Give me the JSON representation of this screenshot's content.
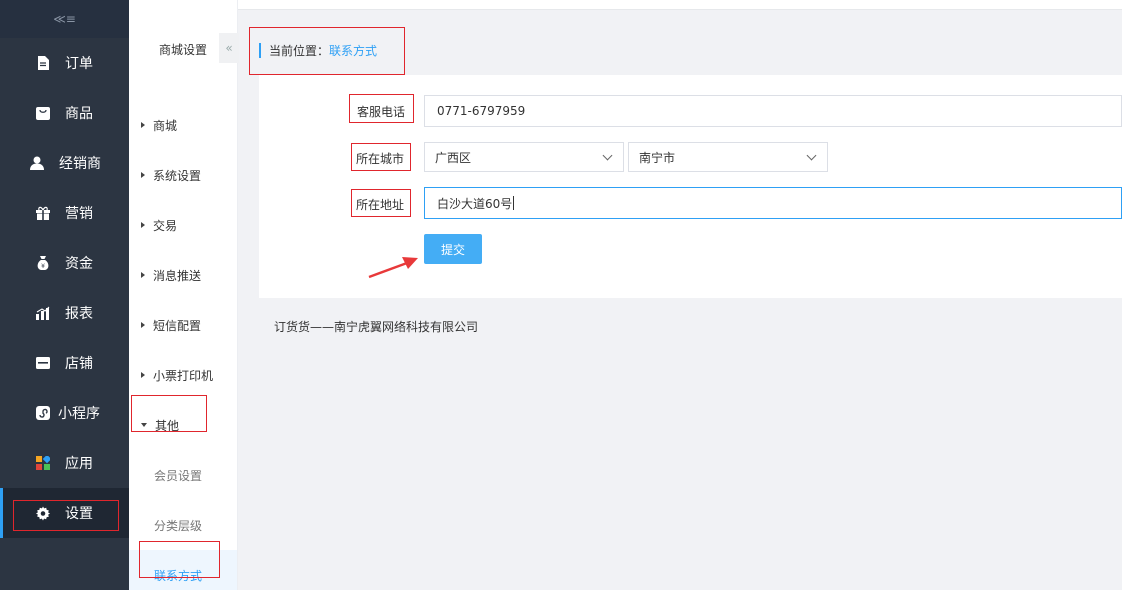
{
  "sidebar": {
    "items": [
      {
        "label": "订单",
        "icon": "document-icon"
      },
      {
        "label": "商品",
        "icon": "bag-icon"
      },
      {
        "label": "经销商",
        "icon": "user-icon"
      },
      {
        "label": "营销",
        "icon": "gift-icon"
      },
      {
        "label": "资金",
        "icon": "money-bag-icon"
      },
      {
        "label": "报表",
        "icon": "bar-chart-icon"
      },
      {
        "label": "店铺",
        "icon": "store-icon"
      },
      {
        "label": "小程序",
        "icon": "miniprogram-icon"
      },
      {
        "label": "应用",
        "icon": "apps-icon"
      },
      {
        "label": "设置",
        "icon": "gear-icon"
      }
    ],
    "active": "设置"
  },
  "subnav": {
    "title": "商城设置",
    "items": [
      "商城",
      "系统设置",
      "交易",
      "消息推送",
      "短信配置",
      "小票打印机"
    ],
    "open_group": "其他",
    "children": [
      "会员设置",
      "分类层级",
      "联系方式"
    ],
    "active_child": "联系方式"
  },
  "breadcrumb": {
    "prefix": "当前位置：",
    "current": "联系方式"
  },
  "form": {
    "phone_label": "客服电话",
    "phone_value": "0771-6797959",
    "city_label": "所在城市",
    "province_value": "广西区",
    "city_value": "南宁市",
    "address_label": "所在地址",
    "address_value": "白沙大道60号",
    "submit_label": "提交"
  },
  "footer": {
    "text": "订货货——南宁虎翼网络科技有限公司"
  },
  "colors": {
    "sidebar_bg": "#2c3542",
    "accent": "#2ea0f5",
    "button": "#44adf5",
    "highlight_box": "#e0262d",
    "arrow": "#e8393a"
  }
}
